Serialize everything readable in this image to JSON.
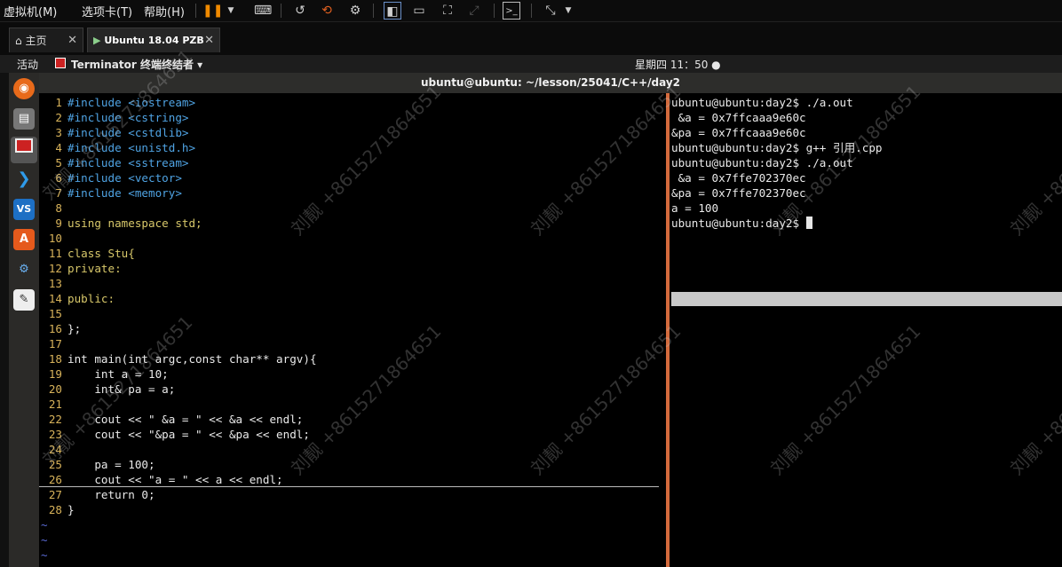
{
  "vm_menubar": {
    "menus": [
      "虚拟机(M)",
      "选项卡(T)",
      "帮助(H)"
    ]
  },
  "vm_tabs": [
    {
      "label": "主页",
      "active": false
    },
    {
      "label": "Ubuntu 18.04 PZB",
      "active": true
    }
  ],
  "ubuntu_topbar": {
    "activities": "活动",
    "app_menu": "Terminator 终端终结者 ▾",
    "clock": "星期四 11：50 ●"
  },
  "terminal": {
    "title": "ubuntu@ubuntu: ~/lesson/25041/C++/day2",
    "accent_color": "#d36a3c"
  },
  "editor": {
    "lines": [
      {
        "n": "1",
        "t": "#include <iostream>"
      },
      {
        "n": "2",
        "t": "#include <cstring>"
      },
      {
        "n": "3",
        "t": "#include <cstdlib>"
      },
      {
        "n": "4",
        "t": "#include <unistd.h>"
      },
      {
        "n": "5",
        "t": "#include <sstream>"
      },
      {
        "n": "6",
        "t": "#include <vector>"
      },
      {
        "n": "7",
        "t": "#include <memory>"
      },
      {
        "n": "8",
        "t": ""
      },
      {
        "n": "9",
        "t": "using namespace std;"
      },
      {
        "n": "10",
        "t": ""
      },
      {
        "n": "11",
        "t": "class Stu{"
      },
      {
        "n": "12",
        "t": "private:"
      },
      {
        "n": "13",
        "t": ""
      },
      {
        "n": "14",
        "t": "public:"
      },
      {
        "n": "15",
        "t": ""
      },
      {
        "n": "16",
        "t": "};"
      },
      {
        "n": "17",
        "t": ""
      },
      {
        "n": "18",
        "t": "int main(int argc,const char** argv){"
      },
      {
        "n": "19",
        "t": "    int a = 10;"
      },
      {
        "n": "20",
        "t": "    int& pa = a;"
      },
      {
        "n": "21",
        "t": ""
      },
      {
        "n": "22",
        "t": "    cout << \" &a = \" << &a << endl;"
      },
      {
        "n": "23",
        "t": "    cout << \"&pa = \" << &pa << endl;"
      },
      {
        "n": "24",
        "t": ""
      },
      {
        "n": "25",
        "t": "    pa = 100;"
      },
      {
        "n": "26",
        "t": "    cout << \"a = \" << a << endl;"
      },
      {
        "n": "27",
        "t": "    return 0;"
      },
      {
        "n": "28",
        "t": "}"
      }
    ],
    "tildes": [
      "~",
      "~",
      "~"
    ]
  },
  "term_output": [
    "ubuntu@ubuntu:day2$ ./a.out",
    " &a = 0x7ffcaaa9e60c",
    "&pa = 0x7ffcaaa9e60c",
    "ubuntu@ubuntu:day2$ g++ 引用.cpp",
    "ubuntu@ubuntu:day2$ ./a.out",
    " &a = 0x7ffe702370ec",
    "&pa = 0x7ffe702370ec",
    "a = 100",
    "ubuntu@ubuntu:day2$ "
  ],
  "watermark": "刘靓 +8615271864651"
}
